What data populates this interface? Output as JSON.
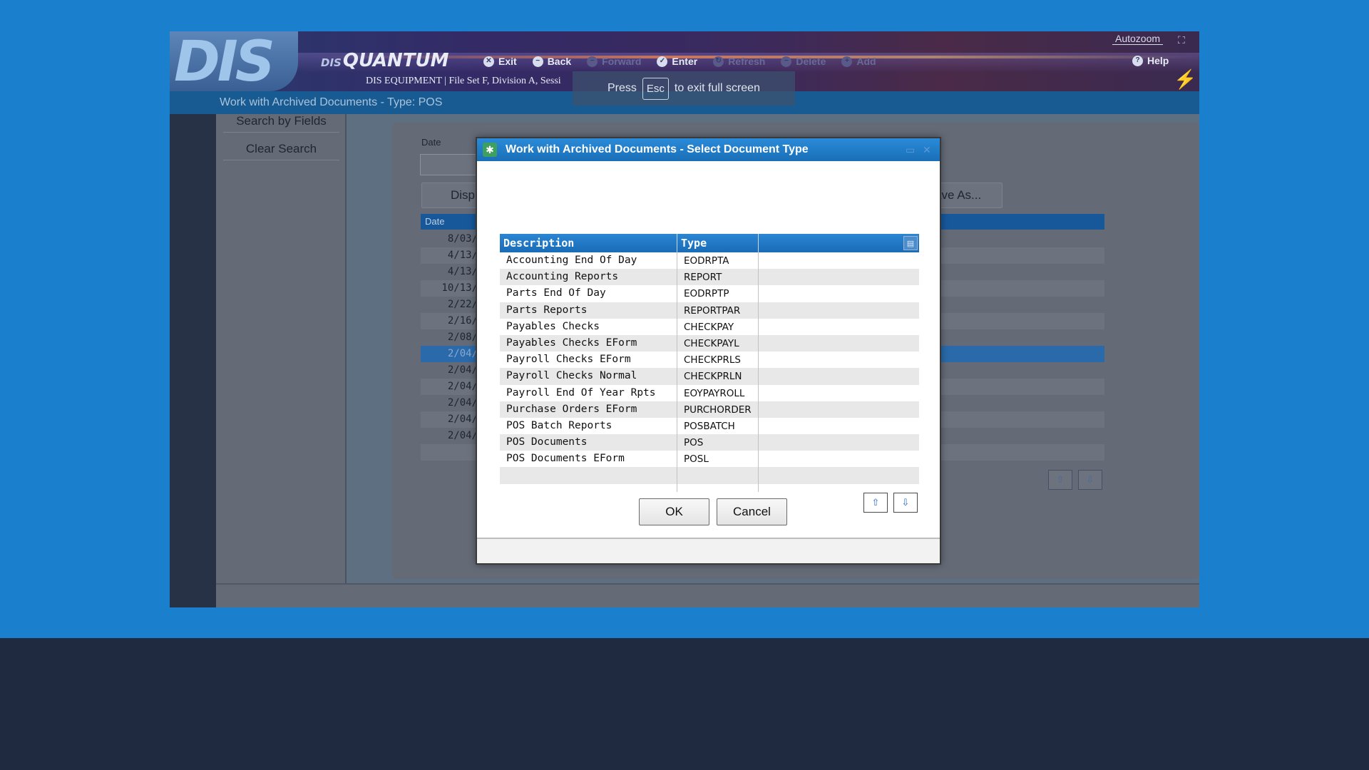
{
  "app": {
    "brand_small": "DIS",
    "brand": "QUANTUM",
    "logo": "DIS",
    "company_info": "DIS EQUIPMENT | File Set F, Division A, Sessi",
    "autozoom_label": "Autozoom",
    "page_title": "Work with Archived Documents - Type: POS",
    "toolbar": {
      "exit": "Exit",
      "back": "Back",
      "forward": "Forward",
      "enter": "Enter",
      "refresh": "Refresh",
      "delete": "Delete",
      "add": "Add",
      "help": "Help"
    }
  },
  "fullscreen_hint": {
    "press": "Press",
    "key": "Esc",
    "suffix": "to exit full screen"
  },
  "left_panel": {
    "search_by_fields": "Search by Fields",
    "clear_search": "Clear Search"
  },
  "background": {
    "date_label": "Date",
    "display_button": "Disp",
    "save_as_button": "ave As...",
    "table_header": "Date",
    "rows": [
      "8/03/",
      "4/13/",
      "4/13/",
      "10/13/",
      "2/22/",
      "2/16/",
      "2/08/",
      "2/04/",
      "2/04/",
      "2/04/",
      "2/04/",
      "2/04/",
      "2/04/"
    ]
  },
  "dialog": {
    "title": "Work with Archived Documents - Select Document Type",
    "columns": {
      "description": "Description",
      "type": "Type"
    },
    "rows": [
      {
        "description": "Accounting End Of Day",
        "type": "EODRPTA"
      },
      {
        "description": "Accounting Reports",
        "type": "REPORT"
      },
      {
        "description": "Parts End Of Day",
        "type": "EODRPTP"
      },
      {
        "description": "Parts Reports",
        "type": "REPORTPAR"
      },
      {
        "description": "Payables Checks",
        "type": "CHECKPAY"
      },
      {
        "description": "Payables Checks EForm",
        "type": "CHECKPAYL"
      },
      {
        "description": "Payroll Checks EForm",
        "type": "CHECKPRLS"
      },
      {
        "description": "Payroll Checks Normal",
        "type": "CHECKPRLN"
      },
      {
        "description": "Payroll End Of Year Rpts",
        "type": "EOYPAYROLL"
      },
      {
        "description": "Purchase Orders EForm",
        "type": "PURCHORDER"
      },
      {
        "description": "POS Batch Reports",
        "type": "POSBATCH"
      },
      {
        "description": "POS Documents",
        "type": "POS"
      },
      {
        "description": "POS Documents EForm",
        "type": "POSL"
      },
      {
        "description": "",
        "type": ""
      }
    ],
    "ok_label": "OK",
    "cancel_label": "Cancel"
  },
  "colors": {
    "accent": "#1a7fcc",
    "header_bar": "#185b92",
    "grid_header": "#1a6cb6"
  },
  "icons": [
    "exit-icon",
    "back-icon",
    "forward-icon",
    "enter-icon",
    "refresh-icon",
    "delete-icon",
    "add-icon",
    "help-icon",
    "fullscreen-icon",
    "lightning-icon",
    "dialog-app-icon",
    "grid-settings-icon",
    "arrow-up-icon",
    "arrow-down-icon"
  ]
}
